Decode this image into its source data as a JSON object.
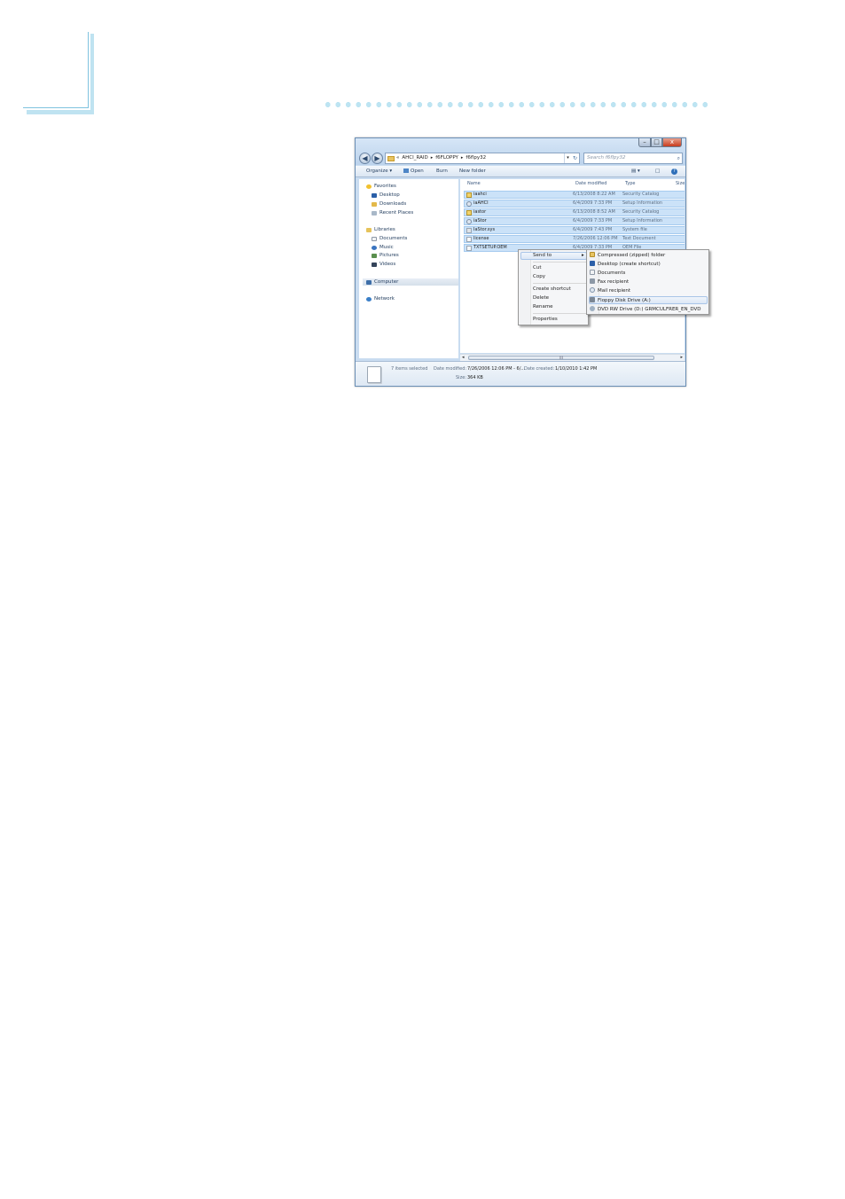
{
  "window": {
    "title_controls": {
      "minimize": "–",
      "maximize": "□",
      "close": "x"
    },
    "nav": {
      "back": "◀",
      "forward": "▶"
    },
    "address": {
      "prefix": "«",
      "crumbs": [
        "AHCI_RAID",
        "f6FLOPPY",
        "f6flpy32"
      ],
      "separator": "▸"
    },
    "search": {
      "placeholder": "Search f6flpy32"
    }
  },
  "toolbar": {
    "organize": "Organize ▾",
    "open": "Open",
    "burn": "Burn",
    "new_folder": "New folder",
    "view": "▤ ▾",
    "preview": "□",
    "help": "?"
  },
  "navpane": {
    "favorites": "Favorites",
    "desktop": "Desktop",
    "downloads": "Downloads",
    "recent_places": "Recent Places",
    "libraries": "Libraries",
    "documents": "Documents",
    "music": "Music",
    "pictures": "Pictures",
    "videos": "Videos",
    "computer": "Computer",
    "network": "Network"
  },
  "columns": {
    "name": "Name",
    "date_modified": "Date modified",
    "type": "Type",
    "size": "Size"
  },
  "files": [
    {
      "name": "iaahci",
      "date": "6/13/2008 8:22 AM",
      "type": "Security Catalog",
      "icon": "cat"
    },
    {
      "name": "iaAHCI",
      "date": "6/4/2009 7:33 PM",
      "type": "Setup Information",
      "icon": "inf"
    },
    {
      "name": "iastor",
      "date": "6/13/2008 8:52 AM",
      "type": "Security Catalog",
      "icon": "cat"
    },
    {
      "name": "iaStor",
      "date": "6/4/2009 7:33 PM",
      "type": "Setup Information",
      "icon": "inf"
    },
    {
      "name": "IaStor.sys",
      "date": "6/4/2009 7:43 PM",
      "type": "System file",
      "icon": "sys"
    },
    {
      "name": "license",
      "date": "7/26/2006 12:06 PM",
      "type": "Text Document",
      "icon": "txt"
    },
    {
      "name": "TXTSETUP.OEM",
      "date": "6/4/2009 7:33 PM",
      "type": "OEM File",
      "icon": "txt"
    }
  ],
  "scroll": {
    "left": "◂",
    "right": "▸",
    "grip": "III"
  },
  "details": {
    "selected": "7 items selected",
    "date_modified_label": "Date modified:",
    "date_modified_value": "7/26/2006 12:06 PM - 6/...",
    "date_created_label": "Date created:",
    "date_created_value": "1/10/2010 1:42 PM",
    "size_label": "Size:",
    "size_value": "364 KB"
  },
  "context_menu": {
    "send_to": "Send to",
    "arrow": "▸",
    "cut": "Cut",
    "copy": "Copy",
    "create_shortcut": "Create shortcut",
    "delete": "Delete",
    "rename": "Rename",
    "properties": "Properties"
  },
  "send_to_menu": {
    "compressed": "Compressed (zipped) folder",
    "desktop": "Desktop (create shortcut)",
    "documents": "Documents",
    "fax": "Fax recipient",
    "mail": "Mail recipient",
    "floppy": "Floppy Disk Drive (A:)",
    "dvd": "DVD RW Drive (D:) GRMCULFRER_EN_DVD"
  },
  "colors": {
    "accent": "#bfe3f1",
    "selection": "#cbe2f8",
    "selection_border": "#a6cbef",
    "window_frame": "#c9dcf0"
  }
}
